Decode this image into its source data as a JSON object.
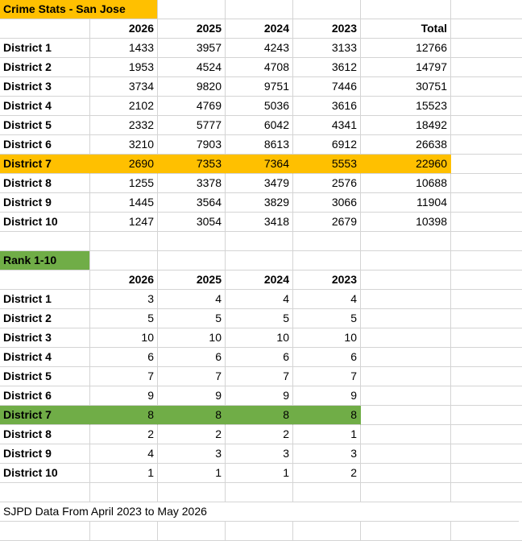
{
  "table1": {
    "title": "Crime Stats - San Jose",
    "headers": [
      "2026",
      "2025",
      "2024",
      "2023",
      "Total"
    ],
    "rows": [
      {
        "label": "District 1",
        "values": [
          "1433",
          "3957",
          "4243",
          "3133",
          "12766"
        ]
      },
      {
        "label": "District 2",
        "values": [
          "1953",
          "4524",
          "4708",
          "3612",
          "14797"
        ]
      },
      {
        "label": "District 3",
        "values": [
          "3734",
          "9820",
          "9751",
          "7446",
          "30751"
        ]
      },
      {
        "label": "District 4",
        "values": [
          "2102",
          "4769",
          "5036",
          "3616",
          "15523"
        ]
      },
      {
        "label": "District 5",
        "values": [
          "2332",
          "5777",
          "6042",
          "4341",
          "18492"
        ]
      },
      {
        "label": "District 6",
        "values": [
          "3210",
          "7903",
          "8613",
          "6912",
          "26638"
        ]
      },
      {
        "label": "District 7",
        "values": [
          "2690",
          "7353",
          "7364",
          "5553",
          "22960"
        ]
      },
      {
        "label": "District 8",
        "values": [
          "1255",
          "3378",
          "3479",
          "2576",
          "10688"
        ]
      },
      {
        "label": "District 9",
        "values": [
          "1445",
          "3564",
          "3829",
          "3066",
          "11904"
        ]
      },
      {
        "label": "District 10",
        "values": [
          "1247",
          "3054",
          "3418",
          "2679",
          "10398"
        ]
      }
    ],
    "highlight_color": "#ffc000"
  },
  "table2": {
    "title": "Rank 1-10",
    "headers": [
      "2026",
      "2025",
      "2024",
      "2023"
    ],
    "rows": [
      {
        "label": "District 1",
        "values": [
          "3",
          "4",
          "4",
          "4"
        ]
      },
      {
        "label": "District 2",
        "values": [
          "5",
          "5",
          "5",
          "5"
        ]
      },
      {
        "label": "District 3",
        "values": [
          "10",
          "10",
          "10",
          "10"
        ]
      },
      {
        "label": "District 4",
        "values": [
          "6",
          "6",
          "6",
          "6"
        ]
      },
      {
        "label": "District 5",
        "values": [
          "7",
          "7",
          "7",
          "7"
        ]
      },
      {
        "label": "District 6",
        "values": [
          "9",
          "9",
          "9",
          "9"
        ]
      },
      {
        "label": "District 7",
        "values": [
          "8",
          "8",
          "8",
          "8"
        ]
      },
      {
        "label": "District 8",
        "values": [
          "2",
          "2",
          "2",
          "1"
        ]
      },
      {
        "label": "District 9",
        "values": [
          "4",
          "3",
          "3",
          "3"
        ]
      },
      {
        "label": "District 10",
        "values": [
          "1",
          "1",
          "1",
          "2"
        ]
      }
    ],
    "highlight_color": "#70ad47"
  },
  "footnote": "SJPD Data From April 2023 to May 2026"
}
